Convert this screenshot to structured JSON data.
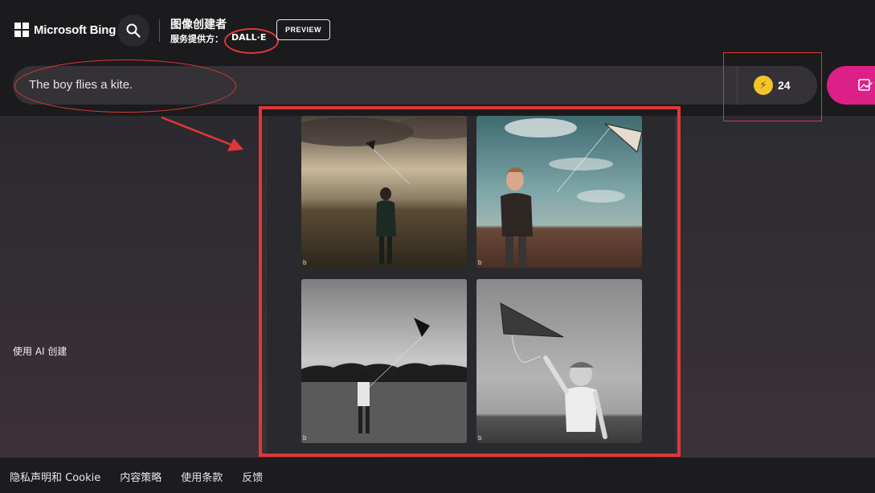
{
  "header": {
    "logo_text": "Microsoft Bing",
    "creator_title": "图像创建者",
    "provider_label": "服务提供方：",
    "provider_name": "DALL·E",
    "preview_label": "PREVIEW",
    "search_icon": "search-icon"
  },
  "prompt": {
    "value": "The boy flies a kite."
  },
  "boosts": {
    "count": "24",
    "icon": "lightning-icon"
  },
  "create_button": {
    "icon": "create-image-icon"
  },
  "sidebar": {
    "ai_label": "使用 AI 创建"
  },
  "results": {
    "images": [
      {
        "description_icon": "image-result-1",
        "watermark": "b"
      },
      {
        "description_icon": "image-result-2",
        "watermark": "b"
      },
      {
        "description_icon": "image-result-3",
        "watermark": "b"
      },
      {
        "description_icon": "image-result-4",
        "watermark": "b"
      }
    ]
  },
  "footer": {
    "links": [
      "隐私声明和 Cookie",
      "内容策略",
      "使用条款",
      "反馈"
    ]
  },
  "colors": {
    "accent_pink": "#dd1f8a",
    "annotation_red": "#e03838",
    "boost_yellow": "#f5c42b"
  }
}
